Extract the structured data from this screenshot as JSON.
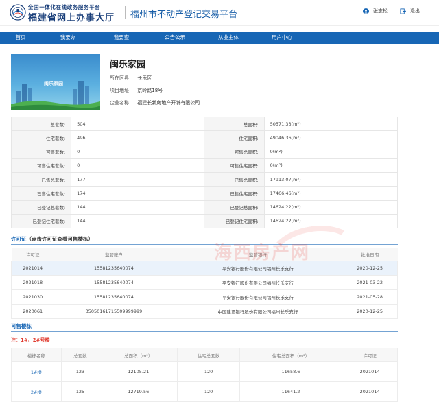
{
  "header": {
    "logo_line1": "全国一体化在线政务服务平台",
    "logo_line2": "福建省网上办事大厅",
    "platform_title": "福州市不动产登记交易平台",
    "user_name": "张志松",
    "logout_label": "退出"
  },
  "nav": {
    "items": [
      "首页",
      "我要办",
      "我要查",
      "公告公示",
      "从业主体",
      "用户中心"
    ]
  },
  "project": {
    "image_caption": "闽乐家园",
    "name": "闽乐家园",
    "district_label": "所在区县",
    "district": "长乐区",
    "address_label": "项目地址",
    "address": "京岭路18号",
    "company_label": "企业名称",
    "company": "福建长新房地产开发有限公司"
  },
  "stats": [
    {
      "k1": "总套数:",
      "v1": "504",
      "k2": "总面积:",
      "v2": "50571.33(m²)"
    },
    {
      "k1": "住宅套数:",
      "v1": "496",
      "k2": "住宅面积:",
      "v2": "49046.36(m²)"
    },
    {
      "k1": "可售套数:",
      "v1": "0",
      "k2": "可售总面积:",
      "v2": "0(m²)"
    },
    {
      "k1": "可售住宅套数:",
      "v1": "0",
      "k2": "可售住宅面积:",
      "v2": "0(m²)"
    },
    {
      "k1": "已售总套数:",
      "v1": "177",
      "k2": "已售总面积:",
      "v2": "17913.07(m²)"
    },
    {
      "k1": "已售住宅套数:",
      "v1": "174",
      "k2": "已售住宅面积:",
      "v2": "17466.46(m²)"
    },
    {
      "k1": "已登记总套数:",
      "v1": "144",
      "k2": "已登记总面积:",
      "v2": "14624.22(m²)"
    },
    {
      "k1": "已登记住宅套数:",
      "v1": "144",
      "k2": "已登记住宅面积:",
      "v2": "14624.22(m²)"
    }
  ],
  "permit_section": {
    "title": "许可证",
    "subtitle": "（点击许可证查看可售楼栋）",
    "headers": [
      "许可证",
      "监管账户",
      "监管银行",
      "批准日期"
    ],
    "rows": [
      [
        "2021014",
        "15581235640074",
        "平安银行股份有限公司福州长乐支行",
        "2020-12-25"
      ],
      [
        "2021018",
        "15581235640074",
        "平安银行股份有限公司福州长乐支行",
        "2021-03-22"
      ],
      [
        "2021030",
        "15581235640074",
        "平安银行股份有限公司福州长乐支行",
        "2021-05-28"
      ],
      [
        "2020061",
        "35050161715509999999",
        "中国建设银行股份有限公司福州长乐支行",
        "2020-12-25"
      ]
    ]
  },
  "watermark": "海西房产网",
  "building_section": {
    "title": "可售楼栋",
    "note": "注：1#、2#号楼",
    "headers": [
      "楼栋名称",
      "总套数",
      "总面积（m²）",
      "住宅总套数",
      "住宅总面积（m²）",
      "许可证"
    ],
    "rows": [
      [
        "1#楼",
        "123",
        "12105.21",
        "120",
        "11658.6",
        "2021014"
      ],
      [
        "2#楼",
        "125",
        "12719.56",
        "120",
        "11641.2",
        "2021014"
      ]
    ]
  },
  "colors": {
    "nav_bg": "#1766b5",
    "brand_dark": "#1a3f7a",
    "note_red": "#e03b2f"
  }
}
